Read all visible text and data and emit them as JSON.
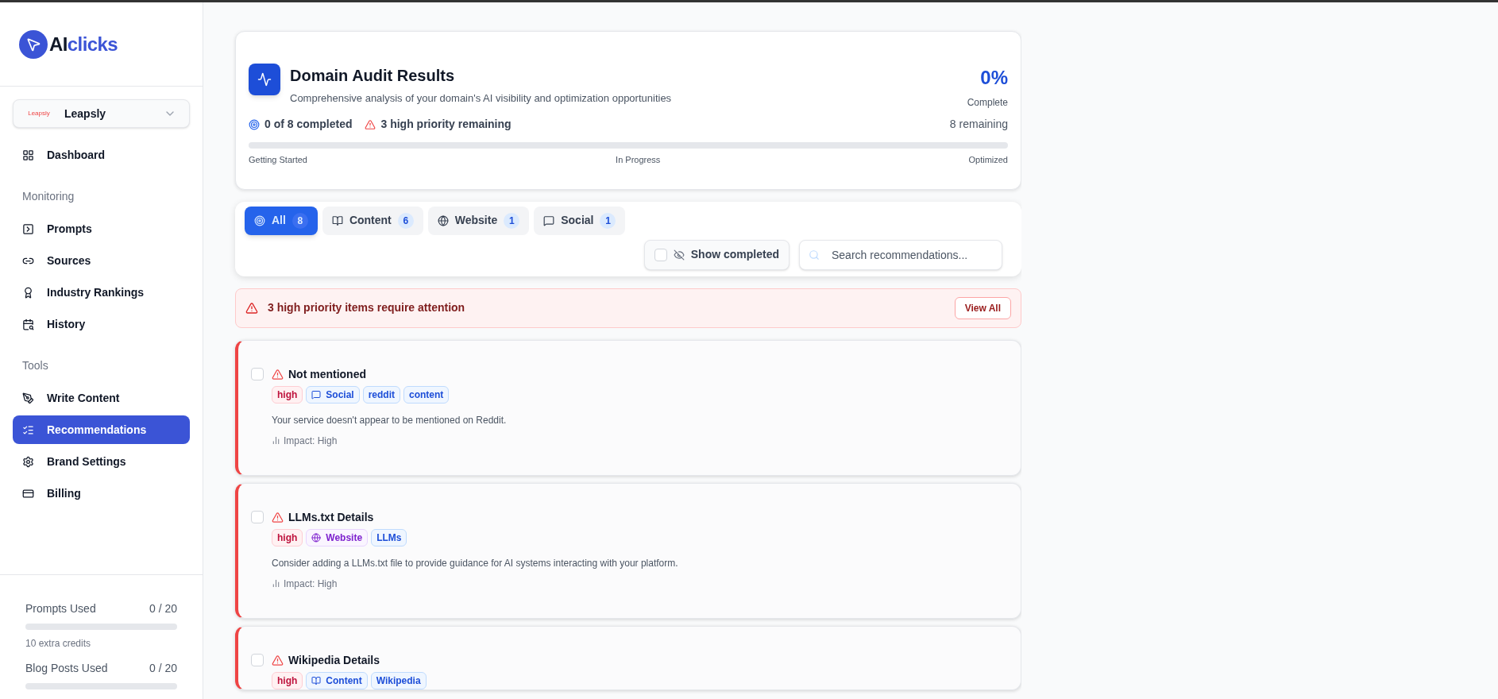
{
  "brand": {
    "logo_text_dark": "AI",
    "logo_text_accent": "clicks"
  },
  "workspace": {
    "logo_text": "Leapsly",
    "name": "Leapsly"
  },
  "nav": [
    {
      "items": [
        {
          "label": "Dashboard",
          "selected": false
        }
      ]
    },
    {
      "heading": "Monitoring",
      "items": [
        {
          "label": "Prompts",
          "selected": false
        },
        {
          "label": "Sources",
          "selected": false
        },
        {
          "label": "Industry Rankings",
          "selected": false
        },
        {
          "label": "History",
          "selected": false
        }
      ]
    },
    {
      "heading": "Tools",
      "items": [
        {
          "label": "Write Content",
          "selected": false
        },
        {
          "label": "Recommendations",
          "selected": true
        },
        {
          "label": "Brand Settings",
          "selected": false
        },
        {
          "label": "Billing",
          "selected": false
        }
      ]
    }
  ],
  "usage": [
    {
      "label": "Prompts Used",
      "reading": "0 / 20",
      "level": 0,
      "note": "10 extra credits"
    },
    {
      "label": "Blog Posts Used",
      "reading": "0 / 20",
      "level": 0
    }
  ],
  "audit": {
    "title": "Domain Audit Results",
    "subtitle": "Comprehensive analysis of your domain's AI visibility and optimization opportunities",
    "percent": "0%",
    "percent_label": "Complete",
    "completed": "0 of 8 completed",
    "priority": "3 high priority remaining",
    "remaining": "8 remaining",
    "level": 0,
    "stages": [
      "Getting Started",
      "In Progress",
      "Optimized"
    ]
  },
  "tabs": [
    {
      "label": "All",
      "count": "8",
      "selected": true
    },
    {
      "label": "Content",
      "count": "6",
      "selected": false
    },
    {
      "label": "Website",
      "count": "1",
      "selected": false
    },
    {
      "label": "Social",
      "count": "1",
      "selected": false
    }
  ],
  "show_completed": {
    "label": "Show completed",
    "checked": false
  },
  "search": {
    "placeholder": "Search recommendations..."
  },
  "alert": {
    "text": "3 high priority items require attention",
    "button": "View All"
  },
  "items": [
    {
      "title": "Not mentioned",
      "checked": false,
      "tags": [
        {
          "kind": "priority",
          "label": "high"
        },
        {
          "kind": "social",
          "label": "Social"
        },
        {
          "kind": "keyword",
          "label": "reddit"
        },
        {
          "kind": "keyword",
          "label": "content"
        }
      ],
      "description": "Your service doesn't appear to be mentioned on Reddit.",
      "impact": "Impact: High"
    },
    {
      "title": "LLMs.txt Details",
      "checked": false,
      "tags": [
        {
          "kind": "priority",
          "label": "high"
        },
        {
          "kind": "website",
          "label": "Website"
        },
        {
          "kind": "keyword",
          "label": "LLMs"
        }
      ],
      "description": "Consider adding a LLMs.txt file to provide guidance for AI systems interacting with your platform.",
      "impact": "Impact: High"
    },
    {
      "title": "Wikipedia Details",
      "checked": false,
      "tags": [
        {
          "kind": "priority",
          "label": "high"
        },
        {
          "kind": "content",
          "label": "Content"
        },
        {
          "kind": "keyword",
          "label": "Wikipedia"
        }
      ]
    }
  ]
}
